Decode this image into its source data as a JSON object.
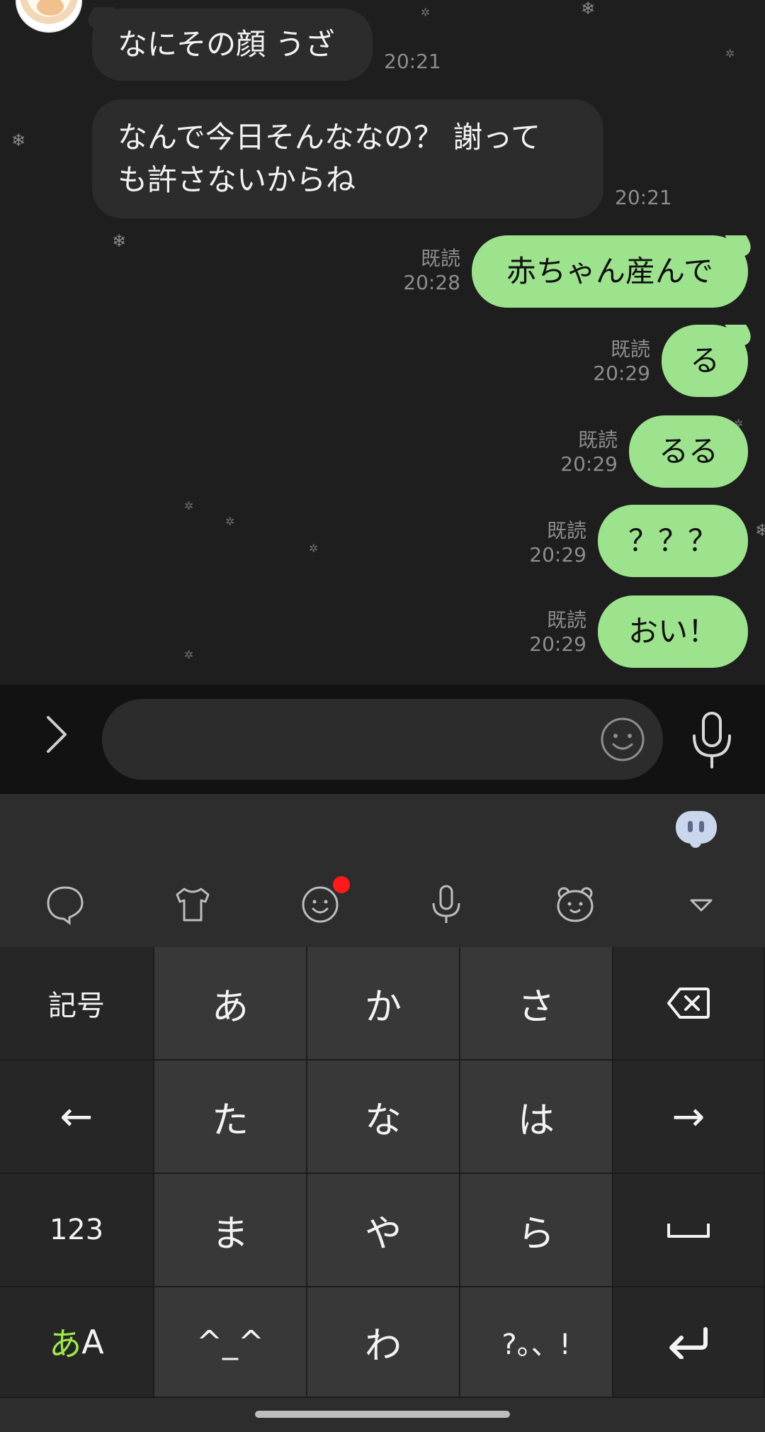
{
  "chat": {
    "incoming": [
      {
        "text": "なにその顔 うざ",
        "time": "20:21"
      },
      {
        "line1": "なんで今日そんななの？ 謝って",
        "line2": "も許さないからね",
        "time": "20:21"
      }
    ],
    "outgoing": [
      {
        "text": "赤ちゃん産んで",
        "read": "既読",
        "time": "20:28"
      },
      {
        "text": "る",
        "read": "既読",
        "time": "20:29"
      },
      {
        "text": "るる",
        "read": "既読",
        "time": "20:29"
      },
      {
        "text": "？？？",
        "read": "既読",
        "time": "20:29"
      },
      {
        "text": "おい！",
        "read": "既読",
        "time": "20:29"
      }
    ]
  },
  "input": {
    "value": "",
    "placeholder": ""
  },
  "keyboard": {
    "toolbar_icons": [
      "speech-bubble-icon",
      "tshirt-icon",
      "emoji-icon",
      "microphone-icon",
      "bear-face-icon",
      "collapse-triangle-icon"
    ],
    "rows": [
      {
        "left": "記号",
        "keys": [
          "あ",
          "か",
          "さ"
        ],
        "right": "⌫"
      },
      {
        "left": "←",
        "keys": [
          "た",
          "な",
          "は"
        ],
        "right": "→"
      },
      {
        "left": "123",
        "keys": [
          "ま",
          "や",
          "ら"
        ],
        "right": "␣"
      },
      {
        "left_a": "あ",
        "left_b": "A",
        "keys": [
          "^_^",
          "わ",
          "?。、!"
        ],
        "right": "↵"
      }
    ]
  },
  "colors": {
    "outgoing_bubble": "#9de38e",
    "incoming_bubble": "#2c2c2c",
    "notification_dot": "#ff1a1a",
    "input_mode_accent": "#9fe94a"
  }
}
